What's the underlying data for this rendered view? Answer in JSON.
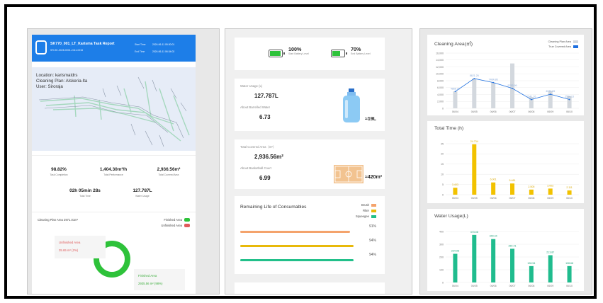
{
  "panel_report": {
    "title": "SK770_001_LT_Karisma Task Report",
    "subtitle": "SR-SK-0028-0001-2411-0016",
    "start_label": "Start Time",
    "start_value": "2024-06-11 05:30:01",
    "end_label": "End Time",
    "end_value": "2024-06-11 06:34:02",
    "location": "Location: karismaldrs",
    "plan": "Cleaning Plan: Alskeria-lta",
    "user": "User: Siroraja",
    "stats": [
      {
        "value": "98.82%",
        "label": "Task Completion"
      },
      {
        "value": "1,404.30m²/h",
        "label": "Total Performance"
      },
      {
        "value": "2,936.56m²",
        "label": "Total Covered Area"
      },
      {
        "value": "02h 05min 28s",
        "label": "Total Time"
      },
      {
        "value": "127.787L",
        "label": "Water Usage"
      }
    ],
    "plan_area": "Cleaning Plan Area 2971.01m²",
    "legend_finished": "Finished Area",
    "legend_unfinished": "Unfinished Area",
    "unfinished_title": "Unfinished Area",
    "unfinished_value": "35.65 m² (2%)",
    "finished_title": "Finished Area",
    "finished_value": "2935.56 m² (98%)",
    "colors": {
      "header": "#1d7ee8",
      "finished": "#2ec23a",
      "unfinished": "#e05a5a"
    }
  },
  "panel_usage": {
    "battery_start": {
      "pct": "100%",
      "label": "Start Battery Level",
      "level": 1.0
    },
    "battery_end": {
      "pct": "70%",
      "label": "End Battery Level",
      "level": 0.7
    },
    "water_label": "Water Usage (L)",
    "water_value": "127.787L",
    "barrel_label": "About Barrelled Water",
    "barrel_value": "6.73",
    "barrel_eq": "≈19L",
    "covered_label": "Total Covered Area（m²）",
    "covered_value": "2,936.56m²",
    "court_label": "About Basketball Court",
    "court_value": "6.99",
    "court_eq": "≈420m²",
    "consumables_title": "Remaining Life of Consumables",
    "consumables": [
      {
        "name": "Brush",
        "pct": "91%",
        "value": 0.91,
        "color": "#f4a36c"
      },
      {
        "name": "Filter",
        "pct": "94%",
        "value": 0.94,
        "color": "#e8b90a"
      },
      {
        "name": "Squeegee",
        "pct": "94%",
        "value": 0.94,
        "color": "#22c08a"
      }
    ]
  },
  "panel_charts": {
    "area_title": "Cleaning Area(㎡)",
    "area_legend_plan": "Cleaning Plan Area",
    "area_legend_covered": "True Covered Area",
    "time_title": "Total Time (h)",
    "water_title": "Water Usage(L)"
  },
  "chart_data": [
    {
      "type": "bar",
      "title": "Cleaning Area(㎡)",
      "categories": [
        "06/04",
        "06/05",
        "06/06",
        "06/07",
        "06/08",
        "06/09",
        "06/10"
      ],
      "ylim": [
        0,
        16000
      ],
      "yticks": [
        0,
        2000,
        4000,
        6000,
        8000,
        10000,
        12000,
        14000,
        16000
      ],
      "series": [
        {
          "name": "Cleaning Plan Area",
          "kind": "bar",
          "color": "#d3d8de",
          "values": [
            4900,
            8621.26,
            7464.86,
            13000,
            3200,
            5000,
            3500
          ]
        },
        {
          "name": "True Covered Area",
          "kind": "line",
          "color": "#1d6fe0",
          "values": [
            4866.78,
            8621.26,
            7464.86,
            5792.99,
            2541.16,
            4072.65,
            2554.13
          ]
        }
      ],
      "data_labels": [
        "4866.78",
        "8621.26",
        "7464.86",
        "5792.99",
        "2541.16",
        "4072.65",
        "2554.13"
      ]
    },
    {
      "type": "bar",
      "title": "Total Time (h)",
      "categories": [
        "06/04",
        "06/05",
        "06/06",
        "06/07",
        "06/08",
        "06/09",
        "06/10"
      ],
      "ylim": [
        0,
        25
      ],
      "yticks": [
        0,
        5,
        10,
        15,
        20,
        25
      ],
      "series": [
        {
          "name": "",
          "color": "#f2c200",
          "values": [
            3.4,
            24.73,
            6.0,
            5.5,
            2.5,
            3.0,
            2.1
          ]
        }
      ],
      "data_labels": [
        "3.403",
        "24.734",
        "6.001",
        "5.481",
        "2.505",
        "3.002",
        "2.111"
      ]
    },
    {
      "type": "bar",
      "title": "Water Usage(L)",
      "categories": [
        "06/04",
        "06/05",
        "06/06",
        "06/07",
        "06/08",
        "06/09",
        "06/10"
      ],
      "ylim": [
        0,
        400
      ],
      "yticks": [
        0,
        100,
        200,
        300,
        400
      ],
      "series": [
        {
          "name": "",
          "color": "#20bc8e",
          "values": [
            224.98,
            373.08,
            340.44,
            264.41,
            128.54,
            213.87,
            128.68
          ]
        }
      ],
      "data_labels": [
        "224.98",
        "373.08",
        "340.44",
        "264.41",
        "128.54",
        "213.87",
        "128.68"
      ]
    }
  ]
}
